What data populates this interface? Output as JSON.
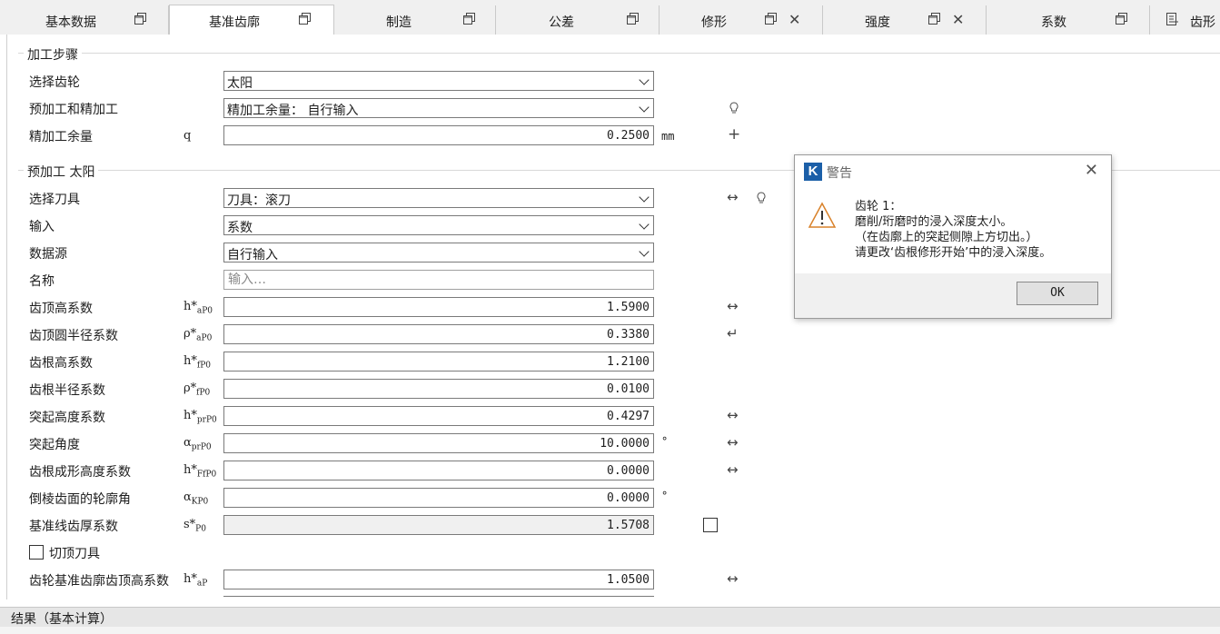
{
  "tabs": [
    {
      "label": "基本数据"
    },
    {
      "label": "基准齿廓"
    },
    {
      "label": "制造"
    },
    {
      "label": "公差"
    },
    {
      "label": "修形"
    },
    {
      "label": "强度"
    },
    {
      "label": "系数"
    },
    {
      "label": "齿形"
    }
  ],
  "section1": {
    "title": "加工步骤",
    "select_gear": {
      "label": "选择齿轮",
      "value": "太阳"
    },
    "pre_finish": {
      "label": "预加工和精加工",
      "value": "精加工余量： 自行输入"
    },
    "allowance": {
      "label": "精加工余量",
      "symbol": "q",
      "value": "0.2500",
      "unit": "mm"
    }
  },
  "section2": {
    "title": "预加工 太阳",
    "tool": {
      "label": "选择刀具",
      "value": "刀具：滚刀"
    },
    "input": {
      "label": "输入",
      "value": "系数"
    },
    "source": {
      "label": "数据源",
      "value": "自行输入"
    },
    "name": {
      "label": "名称",
      "placeholder": "输入…"
    },
    "rows": [
      {
        "label": "齿顶高系数",
        "sym": "h*",
        "sub": "aP0",
        "value": "1.5900"
      },
      {
        "label": "齿顶圆半径系数",
        "sym": "ρ*",
        "sub": "aP0",
        "value": "0.3380"
      },
      {
        "label": "齿根高系数",
        "sym": "h*",
        "sub": "fP0",
        "value": "1.2100"
      },
      {
        "label": "齿根半径系数",
        "sym": "ρ*",
        "sub": "fP0",
        "value": "0.0100"
      },
      {
        "label": "突起高度系数",
        "sym": "h*",
        "sub": "prP0",
        "value": "0.4297"
      },
      {
        "label": "突起角度",
        "sym": "α",
        "sub": "prP0",
        "value": "10.0000",
        "unit": "°"
      },
      {
        "label": "齿根成形高度系数",
        "sym": "h*",
        "sub": "FfP0",
        "value": "0.0000"
      },
      {
        "label": "倒棱齿面的轮廓角",
        "sym": "α",
        "sub": "KP0",
        "value": "0.0000",
        "unit": "°"
      },
      {
        "label": "基准线齿厚系数",
        "sym": "s*",
        "sub": "P0",
        "value": "1.5708"
      }
    ],
    "topping_tool": {
      "label": "切顶刀具"
    },
    "gear_addendum": {
      "label": "齿轮基准齿廓齿顶高系数",
      "sym": "h*",
      "sub": "aP",
      "value": "1.0500"
    }
  },
  "statusbar": {
    "label": "结果（基本计算）"
  },
  "dialog": {
    "title": "警告",
    "logo": "K",
    "line1": "齿轮 1：",
    "line2": "磨削/珩磨时的浸入深度太小。",
    "line3": "（在齿廓上的突起侧隙上方切出。）",
    "line4": "请更改‘齿根修形开始’中的浸入深度。",
    "ok_label": "OK"
  },
  "icons": {
    "restore": "restore-window-icon",
    "close": "close-icon",
    "bulb": "lightbulb-icon",
    "arrow": "double-arrow-icon",
    "enter": "enter-arrow-icon",
    "plus": "plus-icon",
    "warning": "warning-triangle-icon"
  }
}
